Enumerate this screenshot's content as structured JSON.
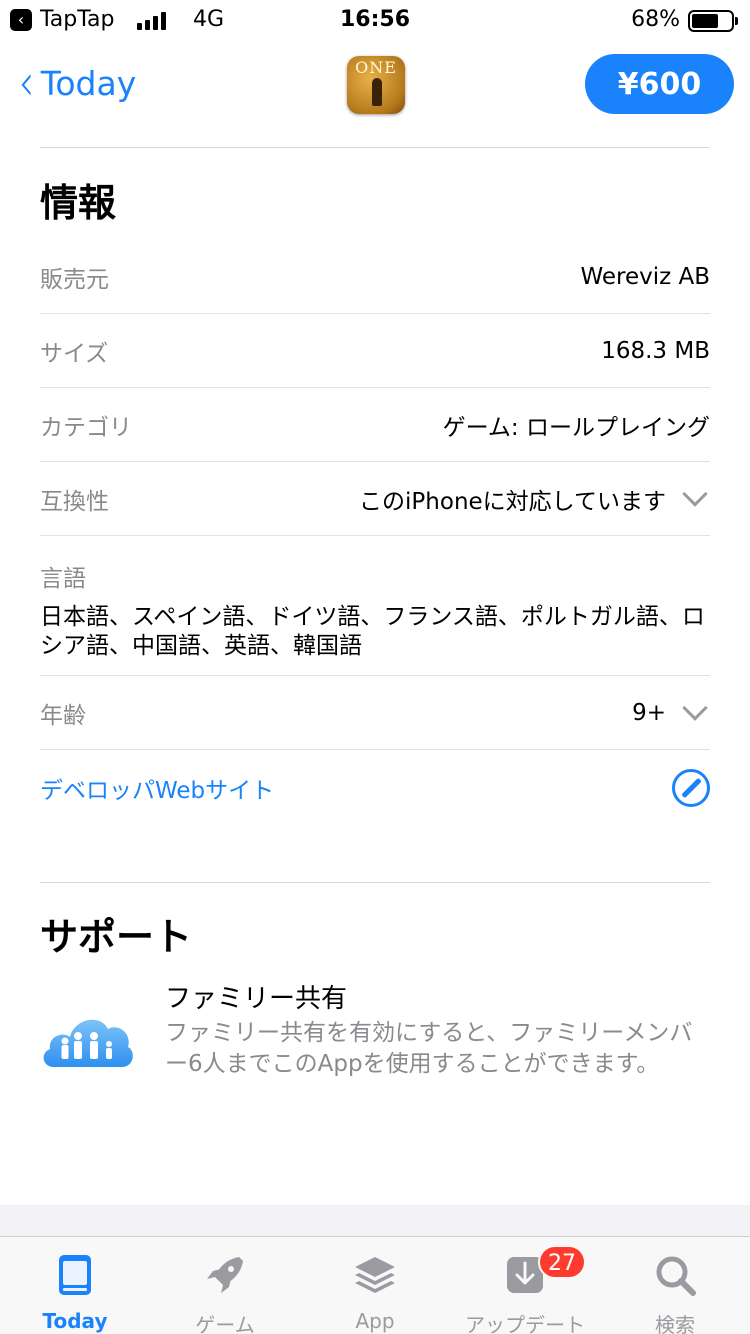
{
  "status_bar": {
    "back_app_glyph": "‹",
    "carrier": "TapTap",
    "network": "4G",
    "time": "16:56",
    "battery_percent": "68%",
    "battery_level": 0.68
  },
  "nav": {
    "back_glyph": "‹",
    "back_label": "Today",
    "app_icon_text": "ONE",
    "price_label": "¥600"
  },
  "info": {
    "title": "情報",
    "rows": [
      {
        "key": "販売元",
        "value": "Wereviz AB"
      },
      {
        "key": "サイズ",
        "value": "168.3 MB"
      },
      {
        "key": "カテゴリ",
        "value": "ゲーム: ロールプレイング"
      },
      {
        "key": "互換性",
        "value": "このiPhoneに対応しています"
      }
    ],
    "languages_key": "言語",
    "languages_value": "日本語、スペイン語、ドイツ語、フランス語、ポルトガル語、ロシア語、中国語、英語、韓国語",
    "age_key": "年齢",
    "age_value": "9+",
    "developer_link": "デベロッパWebサイト"
  },
  "support": {
    "title": "サポート",
    "family_title": "ファミリー共有",
    "family_desc": "ファミリー共有を有効にすると、ファミリーメンバー6人までこのAppを使用することができます。"
  },
  "tabbar": {
    "tabs": [
      {
        "label": "Today",
        "icon": "today-icon",
        "active": true
      },
      {
        "label": "ゲーム",
        "icon": "rocket-icon"
      },
      {
        "label": "App",
        "icon": "stack-icon"
      },
      {
        "label": "アップデート",
        "icon": "download-icon",
        "badge": "27"
      },
      {
        "label": "検索",
        "icon": "search-icon"
      }
    ]
  },
  "colors": {
    "accent": "#1a82fb",
    "secondary_text": "#8a8a8e",
    "badge": "#ff3b30"
  }
}
